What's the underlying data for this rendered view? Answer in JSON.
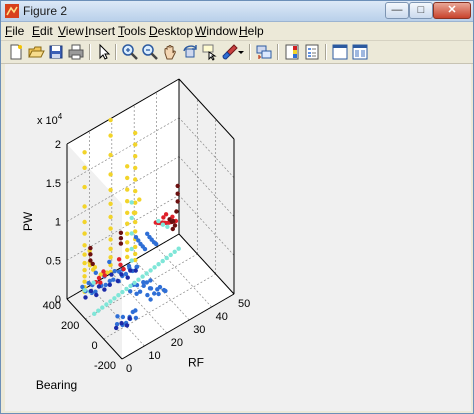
{
  "window": {
    "title": "Figure 2",
    "minimize_glyph": "—",
    "maximize_glyph": "□",
    "close_glyph": "✕"
  },
  "menu": [
    "File",
    "Edit",
    "View",
    "Insert",
    "Tools",
    "Desktop",
    "Window",
    "Help"
  ],
  "toolbar_icons": [
    "new-figure-icon",
    "open-file-icon",
    "save-icon",
    "print-icon",
    "select-arrow-icon",
    "zoom-in-icon",
    "zoom-out-icon",
    "pan-icon",
    "rotate-3d-icon",
    "data-cursor-icon",
    "brush-icon",
    "brush-dropdown-icon",
    "link-plot-icon",
    "colorbar-icon",
    "legend-icon",
    "hide-plot-tools-icon",
    "show-plot-tools-icon"
  ],
  "colors": {
    "yellow": "#f2d42a",
    "blue": "#2f6fd6",
    "red": "#e0202a",
    "darkred": "#6b1010",
    "cyan": "#7fe6d8",
    "navy": "#1c2ba8"
  },
  "chart_data": {
    "type": "scatter",
    "dimension": "3d",
    "xlabel": "RF",
    "ylabel": "Bearing",
    "zlabel": "PW",
    "exponent_label": "x 10",
    "exponent_power": "4",
    "xlim": [
      0,
      50
    ],
    "ylim": [
      -200,
      400
    ],
    "zlim": [
      0,
      20000
    ],
    "x_ticks": [
      "0",
      "10",
      "20",
      "30",
      "40",
      "50"
    ],
    "y_ticks": [
      "-200",
      "0",
      "200",
      "400"
    ],
    "z_ticks": [
      "0",
      "0.5",
      "1",
      "1.5",
      "2"
    ],
    "grid": "on",
    "series": [
      {
        "color": "yellow",
        "points": [
          [
            5,
            330,
            19000
          ],
          [
            5,
            330,
            17000
          ],
          [
            5,
            330,
            14500
          ],
          [
            5,
            330,
            12000
          ],
          [
            5,
            330,
            10000
          ],
          [
            5,
            330,
            8500
          ],
          [
            5,
            330,
            7000
          ],
          [
            5,
            330,
            5800
          ],
          [
            5,
            330,
            4700
          ],
          [
            5,
            330,
            3800
          ],
          [
            5,
            330,
            3000
          ],
          [
            5,
            330,
            2300
          ],
          [
            5,
            330,
            1600
          ],
          [
            5,
            330,
            1000
          ],
          [
            6,
            300,
            6500
          ],
          [
            6,
            300,
            5000
          ],
          [
            7,
            320,
            4200
          ],
          [
            8,
            310,
            3600
          ],
          [
            10,
            340,
            3200
          ],
          [
            11,
            300,
            2600
          ],
          [
            13,
            320,
            2200
          ],
          [
            15,
            330,
            1800
          ],
          [
            17,
            340,
            21000
          ],
          [
            17,
            340,
            19000
          ],
          [
            17,
            340,
            16500
          ],
          [
            17,
            340,
            14000
          ],
          [
            17,
            340,
            12000
          ],
          [
            17,
            340,
            10200
          ],
          [
            17,
            340,
            8500
          ],
          [
            17,
            340,
            7000
          ],
          [
            17,
            340,
            5600
          ],
          [
            17,
            340,
            4400
          ],
          [
            17,
            340,
            3300
          ],
          [
            17,
            340,
            2300
          ],
          [
            17,
            340,
            1400
          ],
          [
            24,
            330,
            14000
          ],
          [
            24,
            330,
            12500
          ],
          [
            24,
            330,
            11000
          ],
          [
            24,
            330,
            9500
          ],
          [
            24,
            330,
            8000
          ],
          [
            24,
            330,
            6600
          ],
          [
            24,
            330,
            5300
          ],
          [
            24,
            330,
            4200
          ],
          [
            24,
            330,
            3200
          ],
          [
            24,
            330,
            2300
          ],
          [
            28,
            340,
            17500
          ],
          [
            28,
            340,
            16000
          ],
          [
            28,
            340,
            14500
          ],
          [
            28,
            340,
            13000
          ],
          [
            28,
            340,
            11500
          ],
          [
            28,
            340,
            10000
          ],
          [
            28,
            340,
            8500
          ],
          [
            28,
            340,
            7200
          ],
          [
            28,
            340,
            6000
          ],
          [
            28,
            340,
            4800
          ],
          [
            28,
            340,
            3800
          ],
          [
            28,
            340,
            2800
          ],
          [
            28,
            340,
            1900
          ],
          [
            28,
            340,
            1100
          ],
          [
            29,
            320,
            9000
          ],
          [
            27,
            330,
            7500
          ]
        ]
      },
      {
        "color": "blue",
        "points": [
          [
            4,
            330,
            1800
          ],
          [
            5,
            320,
            1200
          ],
          [
            6,
            310,
            2200
          ],
          [
            7,
            300,
            900
          ],
          [
            8,
            320,
            1500
          ],
          [
            9,
            310,
            600
          ],
          [
            10,
            330,
            2600
          ],
          [
            11,
            300,
            1300
          ],
          [
            12,
            320,
            700
          ],
          [
            13,
            310,
            1900
          ],
          [
            14,
            320,
            500
          ],
          [
            15,
            300,
            1100
          ],
          [
            16,
            330,
            3000
          ],
          [
            17,
            310,
            800
          ],
          [
            18,
            320,
            1600
          ],
          [
            19,
            300,
            400
          ],
          [
            20,
            320,
            1200
          ],
          [
            21,
            310,
            600
          ],
          [
            22,
            330,
            1000
          ],
          [
            23,
            320,
            400
          ],
          [
            24,
            310,
            1400
          ],
          [
            25,
            330,
            700
          ],
          [
            26,
            320,
            300
          ],
          [
            27,
            300,
            900
          ],
          [
            28,
            320,
            500
          ],
          [
            18,
            150,
            1200
          ],
          [
            19,
            140,
            2000
          ],
          [
            20,
            130,
            800
          ],
          [
            21,
            150,
            1500
          ],
          [
            22,
            140,
            600
          ],
          [
            23,
            130,
            1800
          ],
          [
            24,
            150,
            900
          ],
          [
            25,
            140,
            1300
          ],
          [
            26,
            130,
            500
          ],
          [
            27,
            150,
            1100
          ],
          [
            30,
            380,
            3200
          ],
          [
            31,
            380,
            2600
          ],
          [
            32,
            380,
            2000
          ],
          [
            33,
            380,
            1500
          ],
          [
            34,
            380,
            1000
          ],
          [
            35,
            380,
            2800
          ],
          [
            36,
            380,
            2200
          ],
          [
            37,
            380,
            1700
          ],
          [
            38,
            380,
            1200
          ],
          [
            39,
            380,
            800
          ],
          [
            6,
            0,
            900
          ],
          [
            7,
            20,
            1500
          ],
          [
            8,
            -10,
            600
          ],
          [
            9,
            10,
            1200
          ],
          [
            10,
            0,
            400
          ],
          [
            11,
            -20,
            1000
          ],
          [
            12,
            10,
            700
          ],
          [
            13,
            0,
            1300
          ],
          [
            14,
            -10,
            500
          ],
          [
            15,
            20,
            900
          ],
          [
            22,
            60,
            1200
          ],
          [
            23,
            50,
            600
          ],
          [
            24,
            70,
            1600
          ],
          [
            25,
            60,
            900
          ],
          [
            26,
            50,
            1400
          ],
          [
            27,
            60,
            500
          ],
          [
            28,
            70,
            1100
          ],
          [
            29,
            50,
            800
          ],
          [
            30,
            60,
            400
          ]
        ]
      },
      {
        "color": "red",
        "points": [
          [
            10,
            330,
            1400
          ],
          [
            11,
            320,
            1900
          ],
          [
            12,
            330,
            1000
          ],
          [
            13,
            320,
            2400
          ],
          [
            14,
            330,
            1600
          ],
          [
            20,
            320,
            2800
          ],
          [
            21,
            330,
            1800
          ],
          [
            22,
            320,
            1200
          ],
          [
            38,
            360,
            4000
          ],
          [
            39,
            360,
            3800
          ],
          [
            40,
            360,
            3600
          ],
          [
            41,
            360,
            3500
          ],
          [
            42,
            360,
            3300
          ],
          [
            43,
            360,
            3100
          ],
          [
            44,
            360,
            3000
          ],
          [
            45,
            360,
            2900
          ],
          [
            46,
            360,
            2800
          ],
          [
            47,
            360,
            2700
          ],
          [
            41,
            350,
            4300
          ],
          [
            43,
            370,
            4100
          ],
          [
            45,
            350,
            3700
          ]
        ]
      },
      {
        "color": "darkred",
        "points": [
          [
            8,
            340,
            6000
          ],
          [
            8,
            340,
            5200
          ],
          [
            8,
            340,
            4400
          ],
          [
            9,
            340,
            3800
          ],
          [
            22,
            350,
            5500
          ],
          [
            22,
            350,
            4800
          ],
          [
            22,
            350,
            4100
          ],
          [
            45,
            380,
            3000
          ],
          [
            46,
            380,
            2500
          ],
          [
            47,
            370,
            2000
          ],
          [
            48,
            380,
            3500
          ],
          [
            49,
            390,
            6500
          ],
          [
            49,
            390,
            5500
          ],
          [
            49,
            390,
            4500
          ],
          [
            47,
            390,
            2300
          ],
          [
            46,
            370,
            1700
          ]
        ]
      },
      {
        "color": "cyan",
        "points": [
          [
            4,
            200,
            0
          ],
          [
            6,
            205,
            0
          ],
          [
            8,
            210,
            0
          ],
          [
            10,
            215,
            0
          ],
          [
            12,
            220,
            0
          ],
          [
            14,
            225,
            0
          ],
          [
            16,
            230,
            0
          ],
          [
            18,
            235,
            0
          ],
          [
            20,
            240,
            0
          ],
          [
            22,
            245,
            0
          ],
          [
            24,
            250,
            0
          ],
          [
            26,
            255,
            0
          ],
          [
            28,
            260,
            0
          ],
          [
            30,
            265,
            0
          ],
          [
            32,
            270,
            0
          ],
          [
            34,
            275,
            0
          ],
          [
            36,
            280,
            0
          ],
          [
            38,
            285,
            0
          ],
          [
            40,
            290,
            0
          ],
          [
            42,
            295,
            0
          ],
          [
            44,
            300,
            0
          ],
          [
            46,
            305,
            0
          ],
          [
            5,
            330,
            1200
          ],
          [
            7,
            320,
            800
          ],
          [
            9,
            330,
            1500
          ],
          [
            26,
            330,
            9000
          ],
          [
            26,
            330,
            7000
          ],
          [
            26,
            330,
            5000
          ],
          [
            26,
            330,
            3000
          ],
          [
            26,
            330,
            1500
          ],
          [
            40,
            380,
            3600
          ],
          [
            42,
            380,
            2800
          ],
          [
            44,
            380,
            2200
          ]
        ]
      },
      {
        "color": "navy",
        "points": [
          [
            5,
            320,
            400
          ],
          [
            7,
            310,
            1000
          ],
          [
            9,
            300,
            300
          ],
          [
            11,
            320,
            800
          ],
          [
            13,
            310,
            200
          ],
          [
            15,
            300,
            600
          ],
          [
            17,
            330,
            1200
          ],
          [
            19,
            310,
            300
          ],
          [
            21,
            320,
            700
          ],
          [
            23,
            300,
            200
          ],
          [
            25,
            320,
            500
          ],
          [
            27,
            310,
            300
          ],
          [
            6,
            10,
            300
          ],
          [
            8,
            0,
            700
          ],
          [
            10,
            -10,
            200
          ],
          [
            12,
            10,
            500
          ]
        ]
      }
    ]
  }
}
